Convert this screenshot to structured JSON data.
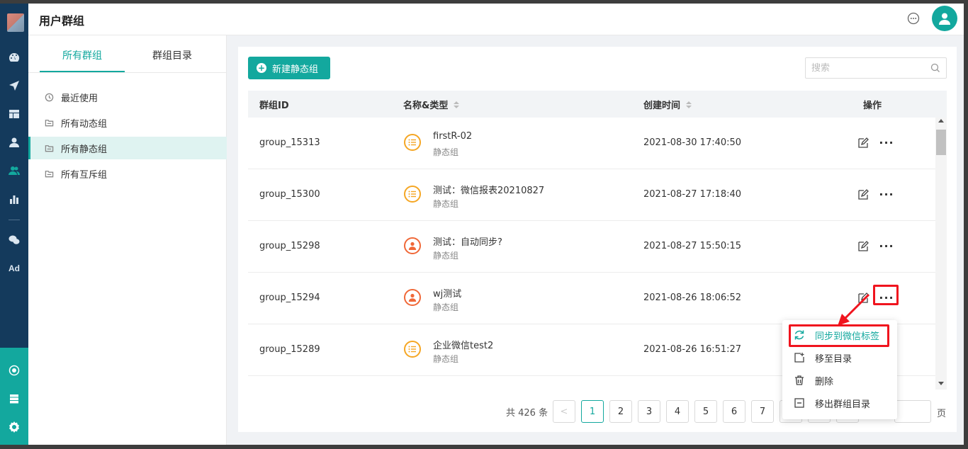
{
  "header": {
    "title": "用户群组"
  },
  "nav": {
    "icons": [
      "dashboard-icon",
      "send-icon",
      "layout-icon",
      "person-icon",
      "group-icon",
      "bar-chart-icon",
      "wechat-icon",
      "ad-icon",
      "analytics-icon",
      "database-icon",
      "gear-icon"
    ],
    "ad_label": "Ad"
  },
  "leftpanel": {
    "tabs": [
      {
        "label": "所有群组",
        "active": true
      },
      {
        "label": "群组目录",
        "active": false
      }
    ],
    "tree": [
      {
        "label": "最近使用",
        "icon": "clock-icon"
      },
      {
        "label": "所有动态组",
        "icon": "folder-icon"
      },
      {
        "label": "所有静态组",
        "icon": "folder-icon",
        "active": true
      },
      {
        "label": "所有互斥组",
        "icon": "folder-icon"
      }
    ]
  },
  "toolbar": {
    "new_button": "新建静态组",
    "search_placeholder": "搜索"
  },
  "table": {
    "headers": {
      "id": "群组ID",
      "name": "名称&类型",
      "time": "创建时间",
      "actions": "操作"
    },
    "rows": [
      {
        "id": "group_15313",
        "name": "firstR-02",
        "type": "静态组",
        "icon": "list-icon",
        "time": "2021-08-30 17:40:50"
      },
      {
        "id": "group_15300",
        "name": "测试：微信报表20210827",
        "type": "静态组",
        "icon": "list-icon",
        "time": "2021-08-27 17:18:40"
      },
      {
        "id": "group_15298",
        "name": "测试：自动同步?",
        "type": "静态组",
        "icon": "person-icon",
        "time": "2021-08-27 15:50:15"
      },
      {
        "id": "group_15294",
        "name": "wj测试",
        "type": "静态组",
        "icon": "person-icon",
        "time": "2021-08-26 18:06:52"
      },
      {
        "id": "group_15289",
        "name": "企业微信test2",
        "type": "静态组",
        "icon": "list-icon",
        "time": "2021-08-26 16:51:27"
      }
    ],
    "more_label": "···"
  },
  "pagination": {
    "total": "共 426 条",
    "prev": "<",
    "pages": [
      "1",
      "2",
      "3",
      "4",
      "5",
      "6",
      "7"
    ],
    "current": "1",
    "suffix": "页"
  },
  "dropdown": {
    "items": [
      {
        "label": "同步到微信标签",
        "icon": "sync-icon",
        "highlight": true
      },
      {
        "label": "移至目录",
        "icon": "move-to-folder-icon"
      },
      {
        "label": "删除",
        "icon": "trash-icon"
      },
      {
        "label": "移出群组目录",
        "icon": "remove-from-folder-icon"
      }
    ]
  },
  "colors": {
    "accent": "#13a89e",
    "nav_bg": "#143a5c",
    "highlight_red": "#f0141e",
    "list_icon": "#f5a623",
    "person_icon": "#f06838"
  }
}
